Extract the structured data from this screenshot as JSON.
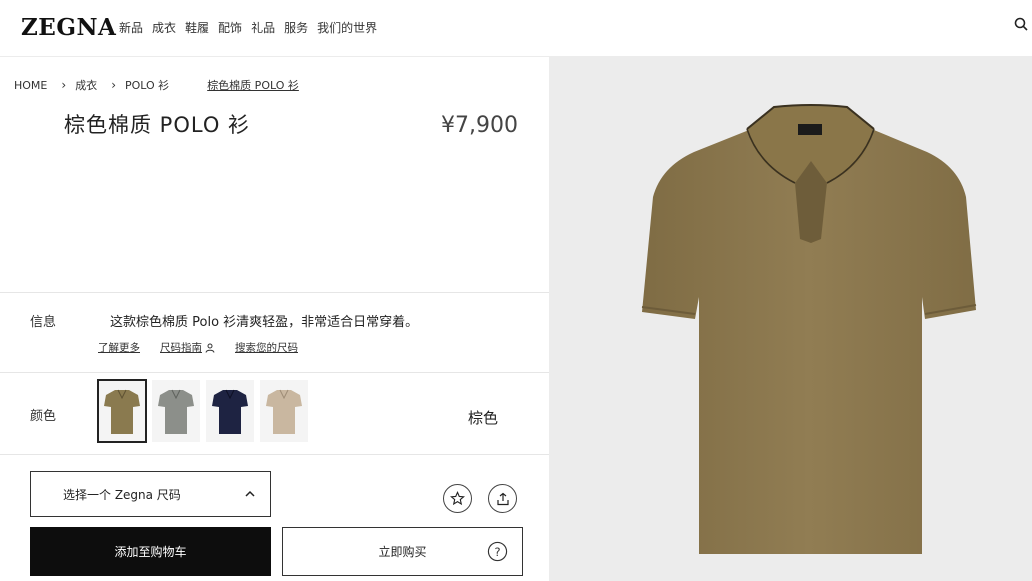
{
  "header": {
    "logo": "ZEGNA",
    "nav": [
      "新品",
      "成衣",
      "鞋履",
      "配饰",
      "礼品",
      "服务",
      "我们的世界"
    ]
  },
  "breadcrumb": {
    "home": "HOME",
    "level1": "成衣",
    "level2": "POLO 衫",
    "current": "棕色棉质 POLO 衫"
  },
  "product": {
    "title": "棕色棉质 POLO 衫",
    "price": "¥7,900",
    "info_label": "信息",
    "description": "这款棕色棉质 Polo 衫清爽轻盈，非常适合日常穿着。",
    "links": {
      "learn_more": "了解更多",
      "size_guide": "尺码指南",
      "find_size": "搜索您的尺码"
    },
    "color_label": "颜色",
    "selected_color": "棕色",
    "swatches": [
      {
        "name": "brown",
        "color": "#8a7a4f"
      },
      {
        "name": "grey",
        "color": "#8c8f8a"
      },
      {
        "name": "navy",
        "color": "#1e2342"
      },
      {
        "name": "beige",
        "color": "#c9b7a0"
      }
    ],
    "size_placeholder": "选择一个 Zegna 尺码",
    "add_to_cart": "添加至购物车",
    "buy_now": "立即购买"
  },
  "image": {
    "shirt_color": "#8f7b51",
    "background": "#ececec"
  },
  "icons": [
    "search-icon",
    "chevron-right-icon",
    "person-icon",
    "chevron-up-icon",
    "star-icon",
    "share-icon",
    "question-icon"
  ]
}
